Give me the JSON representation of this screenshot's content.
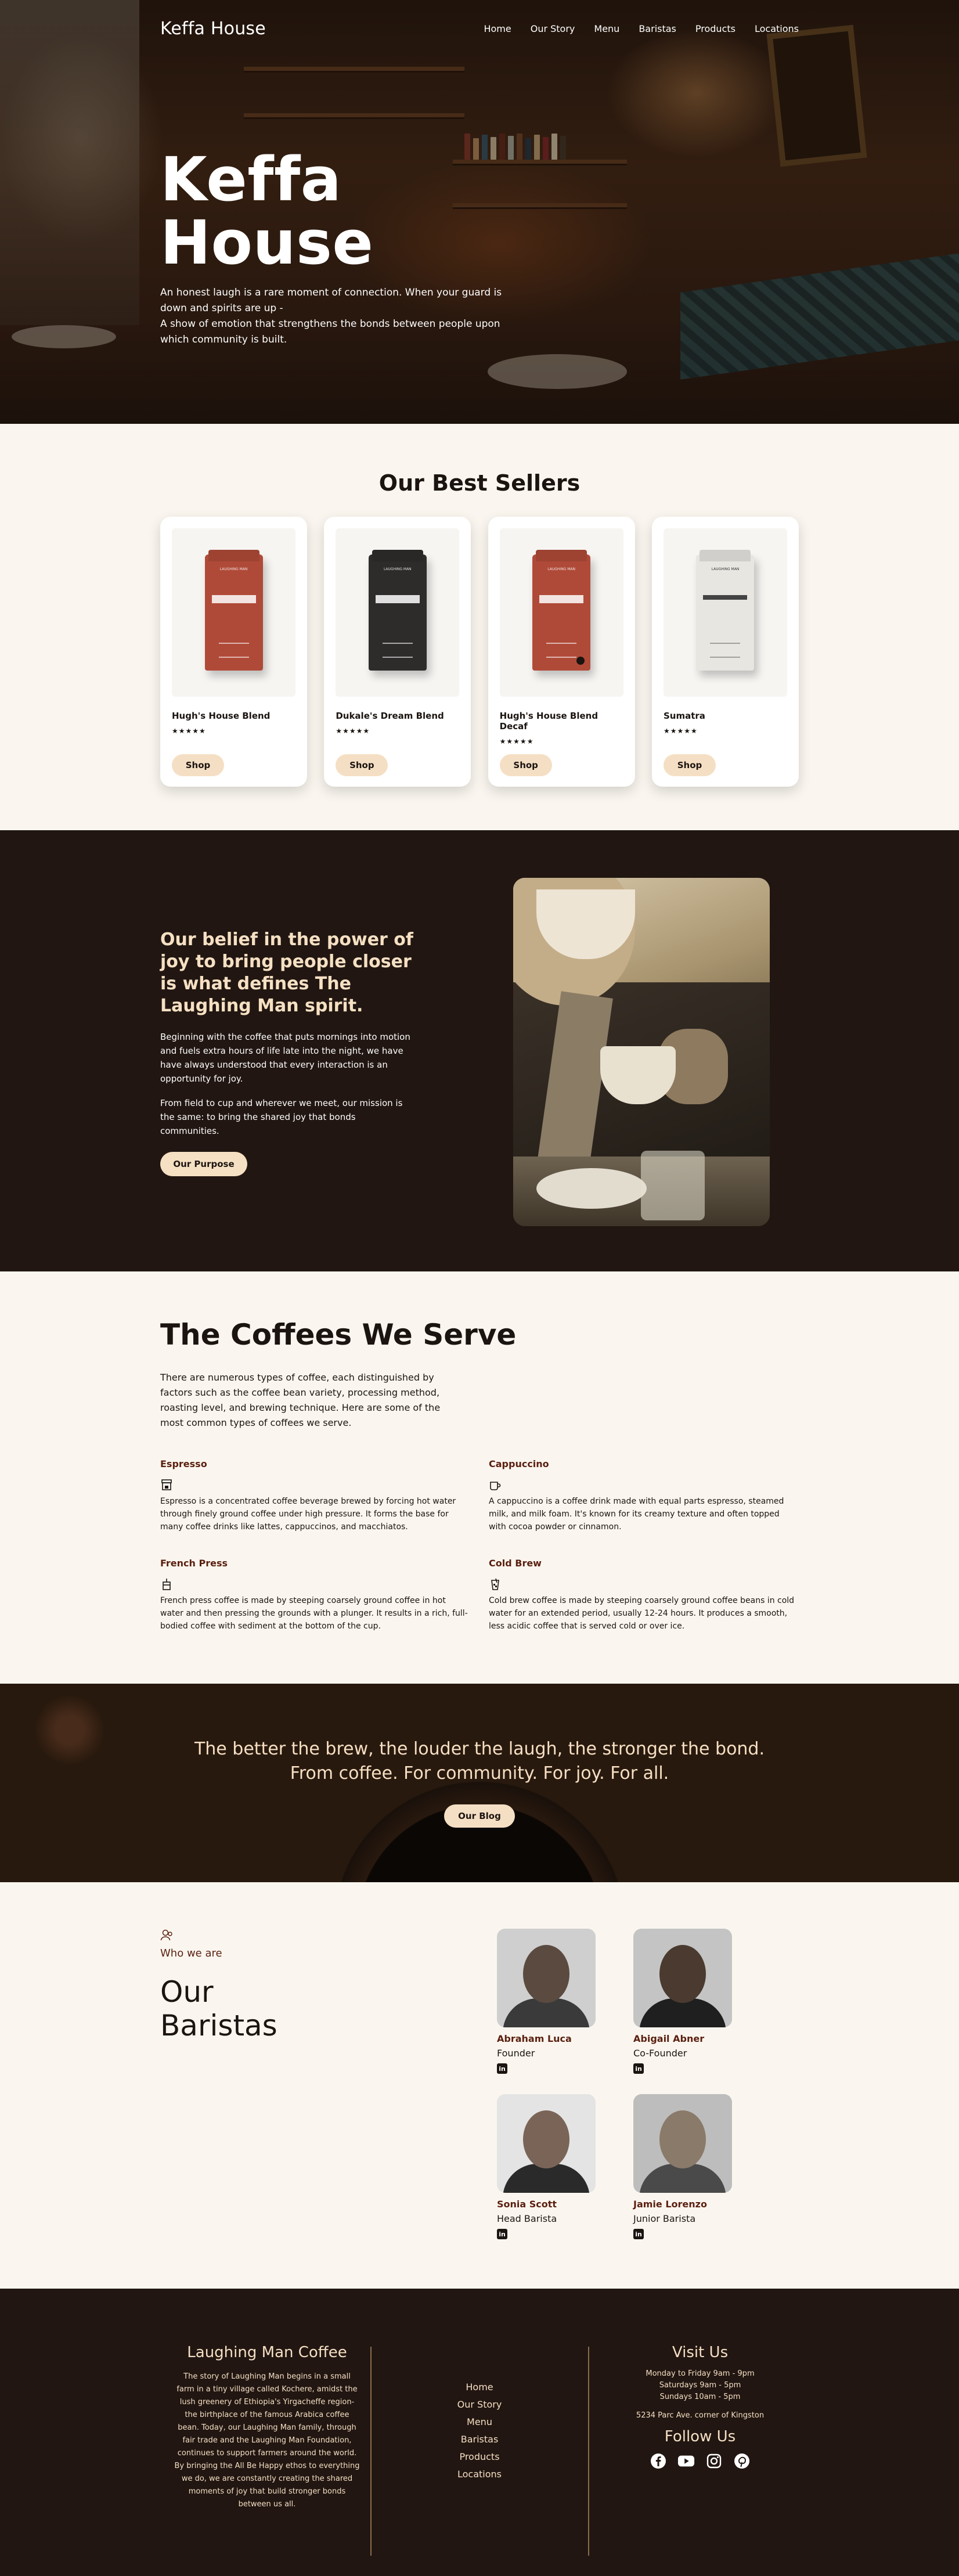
{
  "nav": {
    "brand": "Keffa House",
    "links": [
      "Home",
      "Our Story",
      "Menu",
      "Baristas",
      "Products",
      "Locations"
    ]
  },
  "hero": {
    "title": "Keffa House",
    "lines": [
      "An honest laugh is a rare moment of connection. When your guard is",
      "down and spirits are up -",
      "A show of emotion that strengthens the bonds between people upon",
      "which community is built."
    ]
  },
  "best_sellers": {
    "title": "Our Best Sellers",
    "products": [
      {
        "name": "Hugh's House Blend",
        "stars": "★★★★★",
        "button": "Shop",
        "bag_brand": "LAUGHING MAN",
        "bag_color": "red"
      },
      {
        "name": "Dukale's Dream Blend",
        "stars": "★★★★★",
        "button": "Shop",
        "bag_brand": "LAUGHING MAN",
        "bag_color": "black"
      },
      {
        "name": "Hugh's House Blend Decaf",
        "stars": "★★★★★",
        "button": "Shop",
        "bag_brand": "LAUGHING MAN",
        "bag_color": "red"
      },
      {
        "name": "Sumatra",
        "stars": "★★★★★",
        "button": "Shop",
        "bag_brand": "LAUGHING MAN",
        "bag_color": "white"
      }
    ]
  },
  "belief": {
    "title": "Our belief in the power of joy to bring people closer is what defines The Laughing Man spirit.",
    "paragraphs": [
      "Beginning with the coffee that puts mornings into motion and fuels extra hours of life late into the night, we have have always understood that every interaction is an opportunity for joy.",
      "From field to cup and wherever we meet, our mission is the same: to bring the shared joy that bonds communities."
    ],
    "button": "Our Purpose"
  },
  "coffees": {
    "title": "The Coffees We Serve",
    "intro": "There are numerous types of coffee, each distinguished by factors such as the coffee bean variety, processing method, roasting level, and brewing technique. Here are some of the most common types of coffees we serve.",
    "types": [
      {
        "name": "Espresso",
        "icon": "espresso-machine-icon",
        "description": "Espresso is a concentrated coffee beverage brewed by forcing hot water through finely ground coffee under high pressure. It forms the base for many coffee drinks like lattes, cappuccinos, and macchiatos."
      },
      {
        "name": "Cappuccino",
        "icon": "coffee-mug-icon",
        "description": "A cappuccino is a coffee drink made with equal parts espresso, steamed milk, and milk foam. It's known for its creamy texture and often topped with cocoa powder or cinnamon."
      },
      {
        "name": "French Press",
        "icon": "french-press-icon",
        "description": "French press coffee is made by steeping coarsely ground coffee in hot water and then pressing the grounds with a plunger. It results in a rich, full-bodied coffee with sediment at the bottom of the cup."
      },
      {
        "name": "Cold Brew",
        "icon": "iced-cup-icon",
        "description": "Cold brew coffee is made by steeping coarsely ground coffee beans in cold water for an extended period, usually 12-24 hours. It produces a smooth, less acidic coffee that is served cold or over ice."
      }
    ]
  },
  "quote": {
    "lines": [
      "The better the brew, the louder the laugh, the stronger the bond.",
      "From coffee. For community. For joy. For all."
    ],
    "button": "Our Blog"
  },
  "baristas": {
    "label": "Who we are",
    "title_line1": "Our",
    "title_line2": "Baristas",
    "people": [
      {
        "name": "Abraham Luca",
        "role": "Founder"
      },
      {
        "name": "Abigail Abner",
        "role": "Co-Founder"
      },
      {
        "name": "Sonia Scott",
        "role": "Head Barista"
      },
      {
        "name": "Jamie Lorenzo",
        "role": "Junior Barista"
      }
    ],
    "social_label": "in"
  },
  "footer": {
    "title": "Laughing Man Coffee",
    "about": "The story of Laughing Man begins in a small farm in a tiny village called Kochere, amidst the lush greenery of Ethiopia's Yirgacheffe region-the birthplace of the famous Arabica coffee bean. Today, our Laughing Man family, through fair trade and the Laughing Man Foundation, continues to support farmers around the world. By bringing the All Be Happy ethos to everything we do, we are constantly creating the shared moments of joy that build stronger bonds between us all.",
    "links": [
      "Home",
      "Our Story",
      "Menu",
      "Baristas",
      "Products",
      "Locations"
    ],
    "visit_title": "Visit Us",
    "hours": [
      "Monday to Friday 9am - 9pm",
      "Saturdays 9am - 5pm",
      "Sundays 10am - 5pm"
    ],
    "address": "5234 Parc Ave. corner of Kingston",
    "follow_title": "Follow Us",
    "social": [
      "facebook-icon",
      "youtube-icon",
      "instagram-icon",
      "pinterest-icon"
    ]
  },
  "colors": {
    "accent": "#f5dfc4",
    "dark": "#211611",
    "heading_brown": "#5a1f0f",
    "page_bg": "#faf6ef"
  }
}
